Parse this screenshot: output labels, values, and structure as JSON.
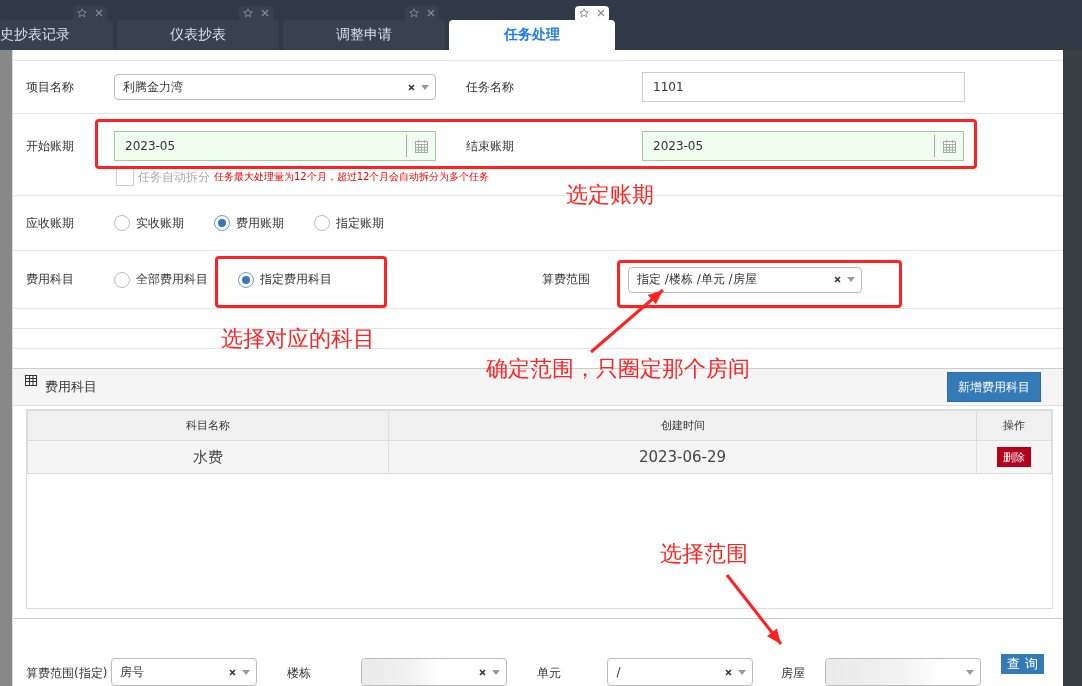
{
  "tabs": [
    {
      "label": "史抄表记录",
      "selected": false
    },
    {
      "label": "仪表抄表",
      "selected": false
    },
    {
      "label": "调整申请",
      "selected": false
    },
    {
      "label": "任务处理",
      "selected": true
    }
  ],
  "form": {
    "project_name": {
      "label": "项目名称",
      "value": "利腾金力湾"
    },
    "task_name": {
      "label": "任务名称",
      "value": "1101"
    },
    "start_period": {
      "label": "开始账期",
      "value": "2023-05"
    },
    "end_period": {
      "label": "结束账期",
      "value": "2023-05"
    },
    "auto_split": {
      "label": "任务自动拆分",
      "checked": false,
      "note": "任务最大处理量为12个月，超过12个月会自动拆分为多个任务"
    },
    "receivable_period": {
      "label": "应收账期",
      "options": [
        {
          "label": "实收账期",
          "selected": false
        },
        {
          "label": "费用账期",
          "selected": true
        },
        {
          "label": "指定账期",
          "selected": false
        }
      ]
    },
    "fee_items": {
      "label": "费用科目",
      "options": [
        {
          "label": "全部费用科目",
          "selected": false
        },
        {
          "label": "指定费用科目",
          "selected": true
        }
      ]
    },
    "fee_scope": {
      "label": "算费范围",
      "value": "指定 /楼栋 /单元 /房屋"
    }
  },
  "panel": {
    "title": "费用科目",
    "add_button": "新增费用科目",
    "table": {
      "columns": [
        "科目名称",
        "创建时间",
        "操作"
      ],
      "rows": [
        {
          "name": "水费",
          "created": "2023-06-29",
          "action": "删除"
        }
      ]
    }
  },
  "filter": {
    "fields": [
      {
        "label": "算费范围(指定)",
        "value": "房号",
        "kind": "select"
      },
      {
        "label": "楼栋",
        "kind": "redacted"
      },
      {
        "label": "单元",
        "value": "/",
        "kind": "select"
      },
      {
        "label": "房屋",
        "kind": "redacted_noclear"
      }
    ],
    "query_button": "查 询"
  },
  "annotations": [
    {
      "text": "选定账期"
    },
    {
      "text": "选择对应的科目"
    },
    {
      "text": "确定范围，只圈定那个房间"
    },
    {
      "text": "选择范围"
    }
  ]
}
